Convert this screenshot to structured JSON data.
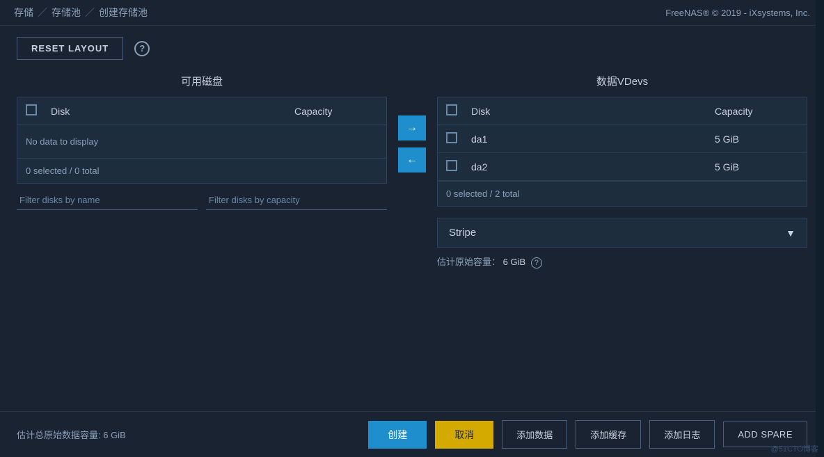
{
  "header": {
    "breadcrumb": [
      "存储",
      "存储池",
      "创建存储池"
    ],
    "brand": "FreeNAS® © 2019 - iXsystems, Inc."
  },
  "toolbar": {
    "reset_label": "RESET LAYOUT",
    "help_icon": "?"
  },
  "left_panel": {
    "title": "可用磁盘",
    "col_disk": "Disk",
    "col_capacity": "Capacity",
    "no_data": "No data to display",
    "footer": "0 selected / 0 total",
    "filter_name_placeholder": "Filter disks by name",
    "filter_capacity_placeholder": "Filter disks by capacity"
  },
  "right_panel": {
    "title": "数据VDevs",
    "col_disk": "Disk",
    "col_capacity": "Capacity",
    "rows": [
      {
        "disk": "da1",
        "capacity": "5 GiB"
      },
      {
        "disk": "da2",
        "capacity": "5 GiB"
      }
    ],
    "footer": "0 selected / 2 total",
    "stripe_label": "Stripe",
    "raw_capacity_label": "估计原始容量：",
    "raw_capacity_value": "6 GiB"
  },
  "bottom": {
    "total_label": "估计总原始数据容量: 6 GiB",
    "btn_create": "创建",
    "btn_cancel": "取消",
    "btn_add_data": "添加数据",
    "btn_add_cache": "添加缓存",
    "btn_add_log": "添加日志",
    "btn_spare": "ADD SPARE"
  },
  "watermark": "@51CTO博客"
}
